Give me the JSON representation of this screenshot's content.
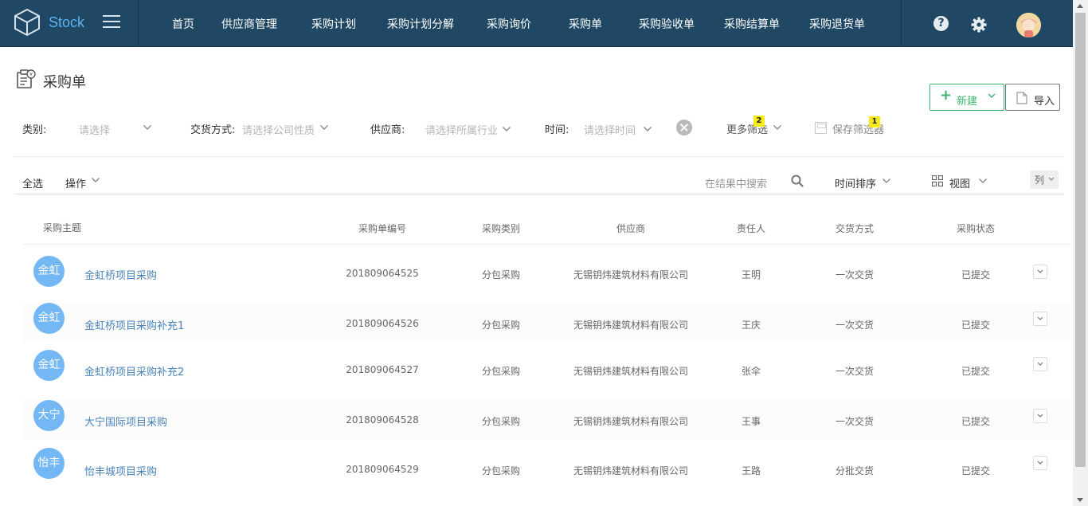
{
  "brand": {
    "name": "Stock"
  },
  "nav": {
    "items": [
      "首页",
      "供应商管理",
      "采购计划",
      "采购计划分解",
      "采购询价",
      "采购单",
      "采购验收单",
      "采购结算单",
      "采购退货单"
    ],
    "help": "?"
  },
  "page": {
    "title": "采购单"
  },
  "actions": {
    "new_label": "新建",
    "import_label": "导入"
  },
  "filters": {
    "category": {
      "label": "类别:",
      "placeholder": "请选择"
    },
    "delivery": {
      "label": "交货方式:",
      "placeholder": "请选择公司性质"
    },
    "supplier": {
      "label": "供应商:",
      "placeholder": "请选择所属行业"
    },
    "time": {
      "label": "时间:",
      "placeholder": "请选择时间"
    },
    "more_label": "更多筛选",
    "more_badge": "2",
    "save_label": "保存筛选器",
    "save_badge": "1"
  },
  "toolbar": {
    "select_all": "全选",
    "operate": "操作",
    "search_placeholder": "在结果中搜索",
    "sort_label": "时间排序",
    "view_label": "视图",
    "columns_label": "列"
  },
  "table": {
    "columns": [
      "采购主题",
      "采购单编号",
      "采购类别",
      "供应商",
      "责任人",
      "交货方式",
      "采购状态"
    ],
    "rows": [
      {
        "avatar": "金虹",
        "topic": "金虹桥项目采购",
        "code": "201809064525",
        "type": "分包采购",
        "supplier": "无锡钥炜建筑材料有限公司",
        "owner": "王明",
        "delivery": "一次交货",
        "status": "已提交"
      },
      {
        "avatar": "金虹",
        "topic": "金虹桥项目采购补充1",
        "code": "201809064526",
        "type": "分包采购",
        "supplier": "无锡钥炜建筑材料有限公司",
        "owner": "王庆",
        "delivery": "一次交货",
        "status": "已提交"
      },
      {
        "avatar": "金虹",
        "topic": "金虹桥项目采购补充2",
        "code": "201809064527",
        "type": "分包采购",
        "supplier": "无锡钥炜建筑材料有限公司",
        "owner": "张伞",
        "delivery": "一次交货",
        "status": "已提交"
      },
      {
        "avatar": "大宁",
        "topic": "大宁国际项目采购",
        "code": "201809064528",
        "type": "分包采购",
        "supplier": "无锡钥炜建筑材料有限公司",
        "owner": "王事",
        "delivery": "一次交货",
        "status": "已提交"
      },
      {
        "avatar": "怡丰",
        "topic": "怡丰城项目采购",
        "code": "201809064529",
        "type": "分包采购",
        "supplier": "无锡钥炜建筑材料有限公司",
        "owner": "王路",
        "delivery": "分批交货",
        "status": "已提交"
      }
    ]
  },
  "colors": {
    "nav_bg": "#204763",
    "brand_text": "#5fb3f2",
    "accent_green": "#3bb36f",
    "avatar_blue": "#74b7f5",
    "link": "#4a83b8",
    "badge": "#f7ea1a"
  },
  "icons": [
    "cube-logo-icon",
    "hamburger-icon",
    "help-icon",
    "gear-icon",
    "avatar",
    "clipboard-icon",
    "plus-icon",
    "document-icon",
    "close-icon",
    "save-icon",
    "search-icon",
    "grid-icon",
    "chevron-down-icon"
  ]
}
